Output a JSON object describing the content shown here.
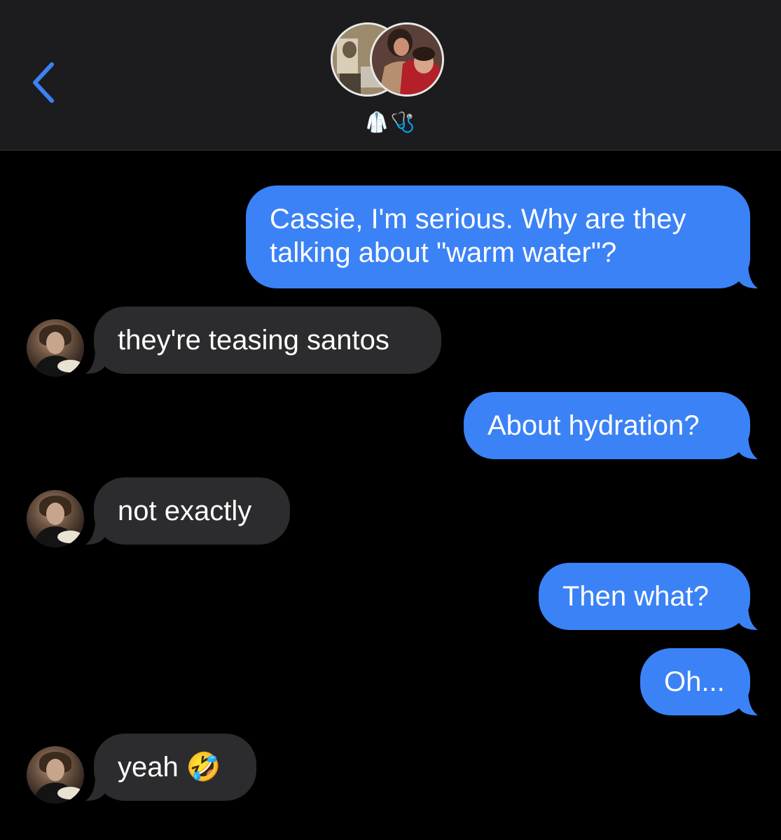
{
  "header": {
    "back_icon": "chevron-left-icon",
    "group_title_emoji": "🥼🩺",
    "accent_color": "#3b82f6"
  },
  "messages": [
    {
      "direction": "sent",
      "text_lines": [
        "Cassie, I'm serious. Why are they",
        "talking about \"warm water\"?"
      ]
    },
    {
      "direction": "received",
      "text": "they're teasing santos"
    },
    {
      "direction": "sent",
      "text": "About hydration?"
    },
    {
      "direction": "received",
      "text": "not exactly"
    },
    {
      "direction": "sent",
      "text": "Then what?"
    },
    {
      "direction": "sent",
      "text": "Oh..."
    },
    {
      "direction": "received",
      "text": "yeah 🤣"
    }
  ],
  "colors": {
    "sent_bubble": "#3b82f6",
    "received_bubble": "#2c2c2e",
    "background": "#000000",
    "header_background": "#1c1c1e"
  }
}
